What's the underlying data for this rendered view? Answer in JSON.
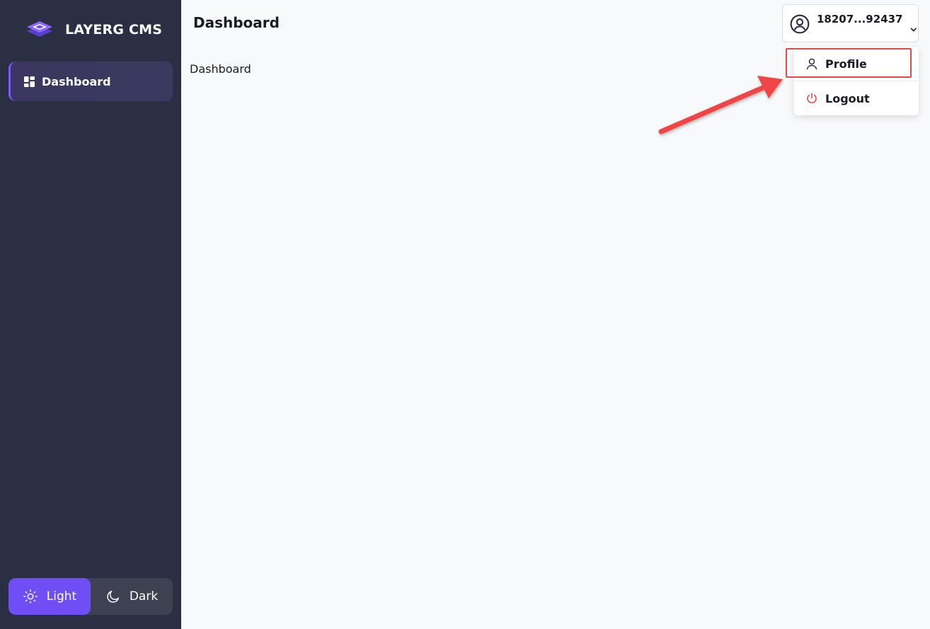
{
  "brand": {
    "name": "LAYERG CMS"
  },
  "sidebar": {
    "items": [
      {
        "label": "Dashboard",
        "icon": "dashboard-grid-icon",
        "active": true
      }
    ],
    "theme": {
      "light_label": "Light",
      "dark_label": "Dark",
      "selected": "Light"
    }
  },
  "header": {
    "title": "Dashboard"
  },
  "main": {
    "content_label": "Dashboard"
  },
  "user_menu": {
    "account": "18207...92437",
    "items": [
      {
        "label": "Profile",
        "icon": "user-icon"
      },
      {
        "label": "Logout",
        "icon": "power-icon"
      }
    ]
  },
  "colors": {
    "sidebar_bg": "#2a2f43",
    "accent": "#6f4ef6",
    "highlight": "#e24b4b",
    "logout_icon": "#e24b4b"
  }
}
